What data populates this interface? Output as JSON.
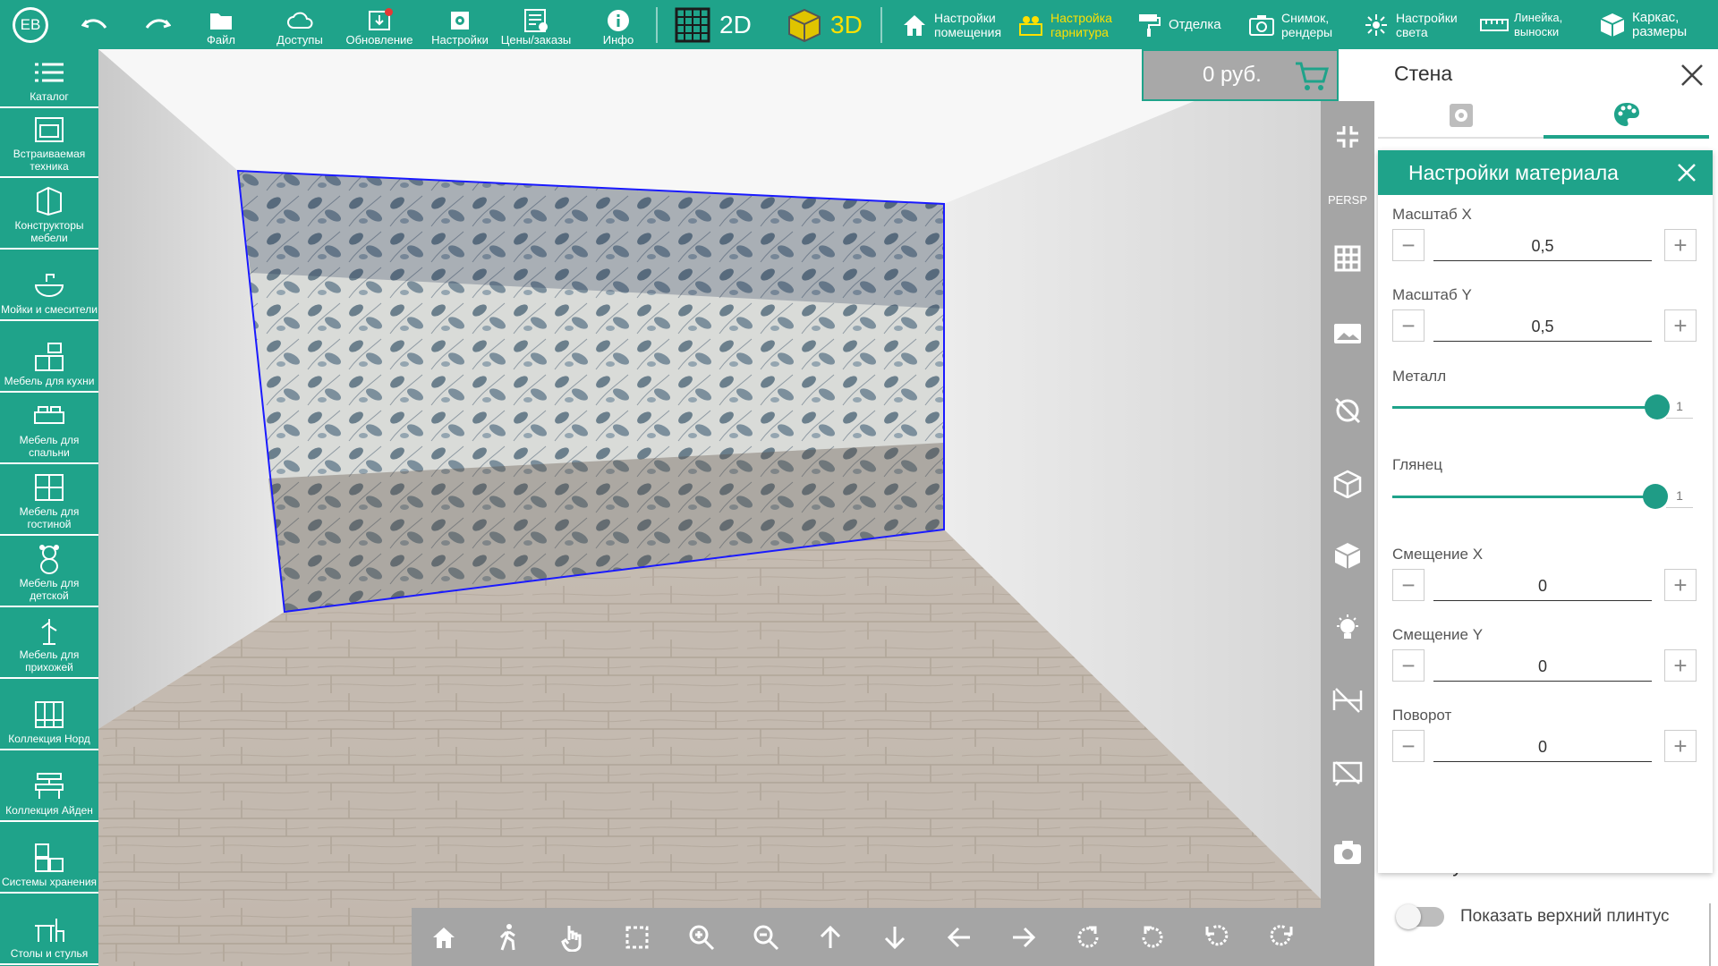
{
  "topbar": {
    "avatar_initials": "EB",
    "items": [
      {
        "label": "Файл",
        "icon": "folder-icon"
      },
      {
        "label": "Доступы",
        "icon": "cloud-icon"
      },
      {
        "label": "Обновление",
        "icon": "update-icon"
      },
      {
        "label": "Настройки",
        "icon": "settings-icon"
      },
      {
        "label": "Цены/заказы",
        "icon": "price-list-icon"
      },
      {
        "label": "Инфо",
        "icon": "info-icon"
      }
    ],
    "view_2d": "2D",
    "view_3d": "3D",
    "right_items": [
      {
        "line1": "Настройки",
        "line2": "помещения",
        "icon": "home-icon"
      },
      {
        "line1": "Настройка",
        "line2": "гарнитура",
        "icon": "kitchen-set-icon"
      },
      {
        "line1": "Отделка",
        "line2": "",
        "icon": "paint-roller-icon"
      },
      {
        "line1": "Снимок,",
        "line2": "рендеры",
        "icon": "camera-icon"
      },
      {
        "line1": "Настройки",
        "line2": "света",
        "icon": "light-icon"
      },
      {
        "line1": "Линейка,",
        "line2": "выноски",
        "icon": "ruler-icon"
      },
      {
        "line1": "Каркас,",
        "line2": "размеры",
        "icon": "box-icon"
      }
    ],
    "accent_color": "#1fa38a",
    "highlight_color": "#ffe000"
  },
  "sidebar": {
    "items": [
      {
        "label": "Каталог",
        "icon": "list-icon"
      },
      {
        "label": "Встраиваемая техника",
        "icon": "oven-icon"
      },
      {
        "label": "Конструкторы мебели",
        "icon": "furniture-constructor-icon"
      },
      {
        "label": "Мойки и смесители",
        "icon": "sink-icon"
      },
      {
        "label": "Мебель для кухни",
        "icon": "kitchen-icon"
      },
      {
        "label": "Мебель для спальни",
        "icon": "bed-icon"
      },
      {
        "label": "Мебель для гостиной",
        "icon": "cabinet-icon"
      },
      {
        "label": "Мебель для детской",
        "icon": "teddy-bear-icon"
      },
      {
        "label": "Мебель для прихожей",
        "icon": "hanger-icon"
      },
      {
        "label": "Коллекция Норд",
        "icon": "wardrobe-icon"
      },
      {
        "label": "Коллекция Айден",
        "icon": "desk-icon"
      },
      {
        "label": "Системы хранения",
        "icon": "shelves-icon"
      },
      {
        "label": "Столы и стулья",
        "icon": "table-chair-icon"
      }
    ]
  },
  "price": {
    "value": "0 руб."
  },
  "toolcol": {
    "persp_label": "PERSP"
  },
  "panel": {
    "title": "Стена",
    "material": {
      "header": "Настройки материала",
      "scale_x_label": "Масштаб X",
      "scale_x_value": "0,5",
      "scale_y_label": "Масштаб Y",
      "scale_y_value": "0,5",
      "metal_label": "Металл",
      "metal_value": "1",
      "gloss_label": "Глянец",
      "gloss_value": "1",
      "offset_x_label": "Смещение X",
      "offset_x_value": "0",
      "offset_y_label": "Смещение Y",
      "offset_y_value": "0",
      "rotation_label": "Поворот",
      "rotation_value": "0"
    },
    "behind_text": "Плинтусы",
    "toggle_label": "Показать верхний плинтус"
  }
}
